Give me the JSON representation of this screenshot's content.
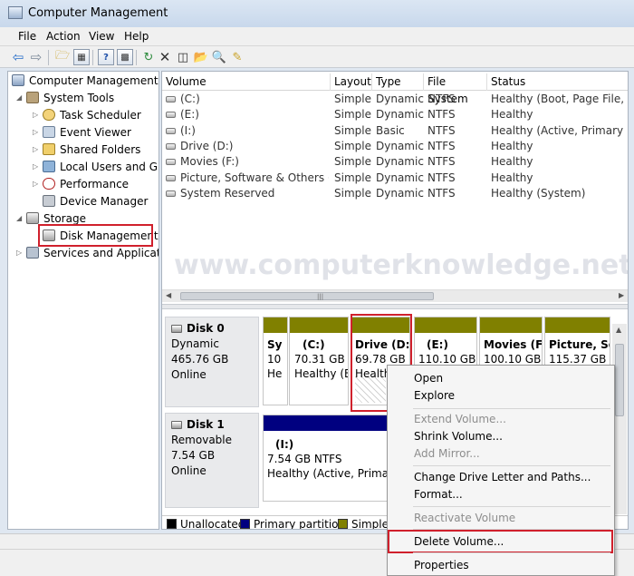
{
  "window": {
    "title": "Computer Management"
  },
  "menu": [
    "File",
    "Action",
    "View",
    "Help"
  ],
  "toolbar_icons": [
    "back-icon",
    "forward-icon",
    "up-folder-icon",
    "show-hide-tree-icon",
    "help-icon",
    "console-icon",
    "refresh-icon",
    "delete-icon",
    "properties-icon",
    "open-folder-icon",
    "search-icon",
    "wizard-icon"
  ],
  "tree": {
    "root": "Computer Management (L",
    "system_tools": "System Tools",
    "task_scheduler": "Task Scheduler",
    "event_viewer": "Event Viewer",
    "shared_folders": "Shared Folders",
    "local_users": "Local Users and Gro",
    "performance": "Performance",
    "device_manager": "Device Manager",
    "storage": "Storage",
    "disk_management": "Disk Management",
    "services": "Services and Application"
  },
  "volume_list": {
    "columns": [
      "Volume",
      "Layout",
      "Type",
      "File System",
      "Status"
    ],
    "rows": [
      {
        "volume": "(C:)",
        "layout": "Simple",
        "type": "Dynamic",
        "fs": "NTFS",
        "status": "Healthy (Boot, Page File, Cras"
      },
      {
        "volume": "(E:)",
        "layout": "Simple",
        "type": "Dynamic",
        "fs": "NTFS",
        "status": "Healthy"
      },
      {
        "volume": "(I:)",
        "layout": "Simple",
        "type": "Basic",
        "fs": "NTFS",
        "status": "Healthy (Active, Primary Part"
      },
      {
        "volume": "Drive (D:)",
        "layout": "Simple",
        "type": "Dynamic",
        "fs": "NTFS",
        "status": "Healthy"
      },
      {
        "volume": "Movies (F:)",
        "layout": "Simple",
        "type": "Dynamic",
        "fs": "NTFS",
        "status": "Healthy"
      },
      {
        "volume": "Picture, Software & Others (G:)",
        "layout": "Simple",
        "type": "Dynamic",
        "fs": "NTFS",
        "status": "Healthy"
      },
      {
        "volume": "System Reserved",
        "layout": "Simple",
        "type": "Dynamic",
        "fs": "NTFS",
        "status": "Healthy (System)"
      }
    ]
  },
  "watermark": "www.computerknowledge.net",
  "disk0": {
    "name": "Disk 0",
    "type": "Dynamic",
    "size": "465.76 GB",
    "status": "Online",
    "partitions": [
      {
        "name": "Sy",
        "l1": "10",
        "l2": "He"
      },
      {
        "name": "(C:)",
        "l1": "70.31 GB N",
        "l2": "Healthy (B"
      },
      {
        "name": "Drive  (D:",
        "l1": "69.78 GB I",
        "l2": "Health"
      },
      {
        "name": "(E:)",
        "l1": "110.10 GB",
        "l2": ""
      },
      {
        "name": "Movies  (F",
        "l1": "100.10 GB",
        "l2": ""
      },
      {
        "name": "Picture, So",
        "l1": "115.37 GB",
        "l2": ""
      }
    ]
  },
  "disk1": {
    "name": "Disk 1",
    "type": "Removable",
    "size": "7.54 GB",
    "status": "Online",
    "partition": {
      "name": "(I:)",
      "l1": "7.54 GB NTFS",
      "l2": "Healthy (Active, Primary"
    }
  },
  "legend": [
    "Unallocated",
    "Primary partition",
    "Simple v"
  ],
  "colors": {
    "unallocated": "#000000",
    "primary": "#000080",
    "simple": "#808000",
    "highlight": "#d0202c"
  },
  "context_menu": {
    "open": "Open",
    "explore": "Explore",
    "extend": "Extend Volume...",
    "shrink": "Shrink Volume...",
    "add_mirror": "Add Mirror...",
    "change_letter": "Change Drive Letter and Paths...",
    "format": "Format...",
    "reactivate": "Reactivate Volume",
    "delete": "Delete Volume...",
    "properties": "Properties"
  }
}
